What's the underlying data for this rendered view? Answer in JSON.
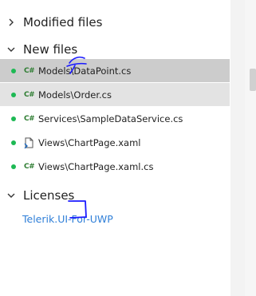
{
  "sections": {
    "modified": {
      "title": "Modified files"
    },
    "new": {
      "title": "New files",
      "files": [
        {
          "name": "Models\\DataPoint.cs",
          "type": "cs",
          "icon": "csharp-file-icon",
          "state": "selected"
        },
        {
          "name": "Models\\Order.cs",
          "type": "cs",
          "icon": "csharp-file-icon",
          "state": "hover"
        },
        {
          "name": "Services\\SampleDataService.cs",
          "type": "cs",
          "icon": "csharp-file-icon",
          "state": ""
        },
        {
          "name": "Views\\ChartPage.xaml",
          "type": "xaml",
          "icon": "xaml-file-icon",
          "state": ""
        },
        {
          "name": "Views\\ChartPage.xaml.cs",
          "type": "cs",
          "icon": "csharp-file-icon",
          "state": ""
        }
      ]
    },
    "licenses": {
      "title": "Licenses",
      "link": "Telerik.UI-For-UWP"
    }
  },
  "icons": {
    "cs_glyph": "C#"
  },
  "colors": {
    "added_dot": "#1db954",
    "link": "#2f7fd8",
    "selected_row": "#cccccc",
    "hover_row": "#e3e3e3",
    "annotation_ink": "#1a1aff"
  }
}
